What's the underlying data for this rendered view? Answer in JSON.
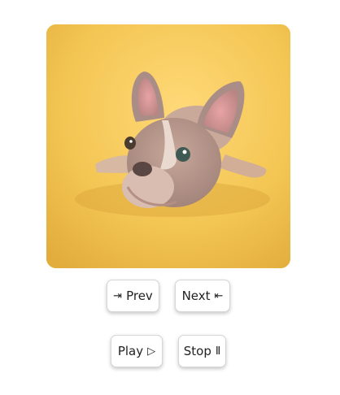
{
  "gallery": {
    "image_subject": "dog-photo",
    "image_alt": ""
  },
  "controls": {
    "prev": {
      "label": "Prev",
      "icon": "arrow-left-to-bar-icon",
      "glyph": "⇥"
    },
    "next": {
      "label": "Next",
      "icon": "arrow-right-to-bar-icon",
      "glyph": "⇤"
    },
    "play": {
      "label": "Play",
      "icon": "play-icon",
      "glyph": "▷"
    },
    "stop": {
      "label": "Stop",
      "icon": "pause-icon",
      "glyph": "Ⅱ"
    }
  },
  "colors": {
    "photo_background": "#f2c75a",
    "button_background": "#ffffff",
    "button_text": "#222222"
  }
}
